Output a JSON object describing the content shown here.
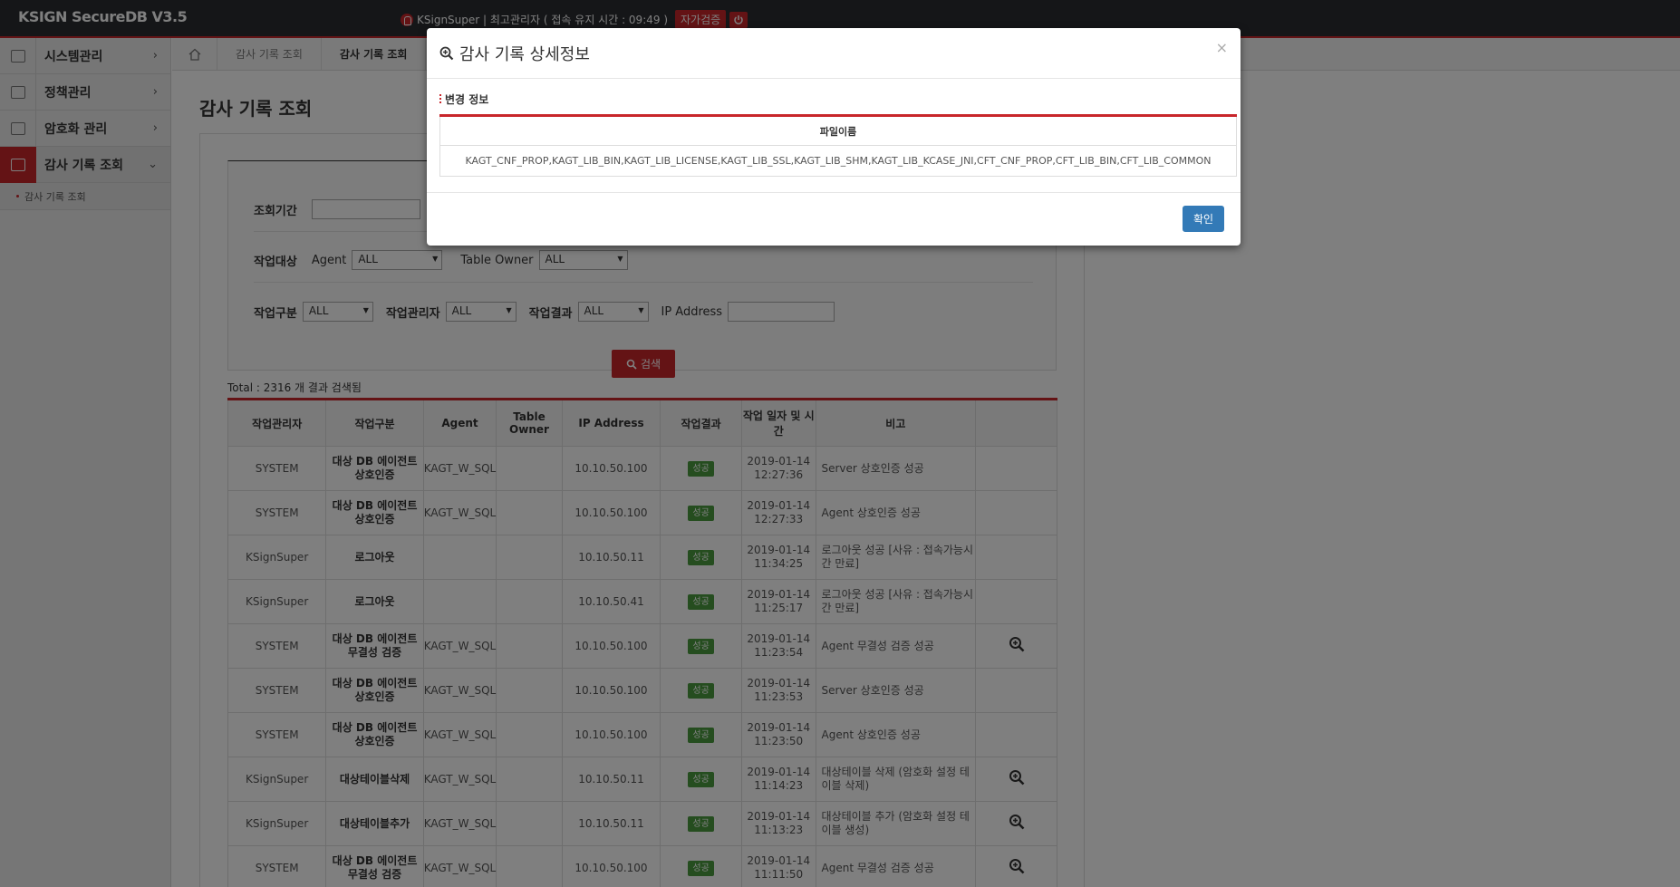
{
  "app": {
    "logo": "KSIGN SecureDB V3.5",
    "user_text": "KSignSuper | 최고관리자 ( 접속 유지 시간 : 09:49 )",
    "verify_label": "자가검증"
  },
  "sidebar": {
    "items": [
      {
        "label": "시스템관리",
        "arrow": "›"
      },
      {
        "label": "정책관리",
        "arrow": "›"
      },
      {
        "label": "암호화 관리",
        "arrow": "›"
      },
      {
        "label": "감사 기록 조회",
        "arrow": "⌄"
      }
    ],
    "sub_items": [
      "감사 기록 조회"
    ]
  },
  "breadcrumb": [
    "감사 기록 조회",
    "감사 기록 조회"
  ],
  "page": {
    "title": "감사 기록 조회"
  },
  "form": {
    "period_label": "조회기간",
    "target_label": "작업대상",
    "agent_label": "Agent",
    "agent_value": "ALL",
    "owner_label": "Table Owner",
    "owner_value": "ALL",
    "type_label": "작업구분",
    "type_value": "ALL",
    "admin_label": "작업관리자",
    "admin_value": "ALL",
    "result_label": "작업결과",
    "result_value": "ALL",
    "ip_label": "IP Address",
    "search_label": "검색"
  },
  "total_text": "Total : 2316 개 결과 검색됨",
  "table": {
    "headers": [
      "작업관리자",
      "작업구분",
      "Agent",
      "Table Owner",
      "IP Address",
      "작업결과",
      "작업 일자 및 시간",
      "비고",
      ""
    ],
    "rows": [
      {
        "admin": "SYSTEM",
        "type": "대상 DB 에이전트 상호인증",
        "agent": "KAGT_W_SQL",
        "owner": "",
        "ip": "10.10.50.100",
        "result": "성공",
        "datetime": "2019-01-14 12:27:36",
        "note": "Server 상호인증 성공",
        "zoom": false
      },
      {
        "admin": "SYSTEM",
        "type": "대상 DB 에이전트 상호인증",
        "agent": "KAGT_W_SQL",
        "owner": "",
        "ip": "10.10.50.100",
        "result": "성공",
        "datetime": "2019-01-14 12:27:33",
        "note": "Agent 상호인증 성공",
        "zoom": false
      },
      {
        "admin": "KSignSuper",
        "type": "로그아웃",
        "agent": "",
        "owner": "",
        "ip": "10.10.50.11",
        "result": "성공",
        "datetime": "2019-01-14 11:34:25",
        "note": "로그아웃 성공 [사유 : 접속가능시간 만료]",
        "zoom": false
      },
      {
        "admin": "KSignSuper",
        "type": "로그아웃",
        "agent": "",
        "owner": "",
        "ip": "10.10.50.41",
        "result": "성공",
        "datetime": "2019-01-14 11:25:17",
        "note": "로그아웃 성공 [사유 : 접속가능시간 만료]",
        "zoom": false
      },
      {
        "admin": "SYSTEM",
        "type": "대상 DB 에이전트 무결성 검증",
        "agent": "KAGT_W_SQL",
        "owner": "",
        "ip": "10.10.50.100",
        "result": "성공",
        "datetime": "2019-01-14 11:23:54",
        "note": "Agent 무결성 검증 성공",
        "zoom": true
      },
      {
        "admin": "SYSTEM",
        "type": "대상 DB 에이전트 상호인증",
        "agent": "KAGT_W_SQL",
        "owner": "",
        "ip": "10.10.50.100",
        "result": "성공",
        "datetime": "2019-01-14 11:23:53",
        "note": "Server 상호인증 성공",
        "zoom": false
      },
      {
        "admin": "SYSTEM",
        "type": "대상 DB 에이전트 상호인증",
        "agent": "KAGT_W_SQL",
        "owner": "",
        "ip": "10.10.50.100",
        "result": "성공",
        "datetime": "2019-01-14 11:23:50",
        "note": "Agent 상호인증 성공",
        "zoom": false
      },
      {
        "admin": "KSignSuper",
        "type": "대상테이블삭제",
        "agent": "KAGT_W_SQL",
        "owner": "",
        "ip": "10.10.50.11",
        "result": "성공",
        "datetime": "2019-01-14 11:14:23",
        "note": "대상테이블 삭제 (암호화 설정 테이블 삭제)",
        "zoom": true
      },
      {
        "admin": "KSignSuper",
        "type": "대상테이블추가",
        "agent": "KAGT_W_SQL",
        "owner": "",
        "ip": "10.10.50.11",
        "result": "성공",
        "datetime": "2019-01-14 11:13:23",
        "note": "대상테이블 추가 (암호화 설정 테이블 생성)",
        "zoom": true
      },
      {
        "admin": "SYSTEM",
        "type": "대상 DB 에이전트 무결성 검증",
        "agent": "KAGT_W_SQL",
        "owner": "",
        "ip": "10.10.50.100",
        "result": "성공",
        "datetime": "2019-01-14 11:11:50",
        "note": "Agent 무결성 검증 성공",
        "zoom": true
      }
    ]
  },
  "modal": {
    "title": "감사 기록 상세정보",
    "section": "변경 정보",
    "column": "파일이름",
    "value": "KAGT_CNF_PROP,KAGT_LIB_BIN,KAGT_LIB_LICENSE,KAGT_LIB_SSL,KAGT_LIB_SHM,KAGT_LIB_KCASE_JNI,CFT_CNF_PROP,CFT_LIB_BIN,CFT_LIB_COMMON",
    "close": "×",
    "ok_label": "확인"
  },
  "colors": {
    "accent": "#c8262b",
    "primary": "#337ab7",
    "success": "#4a9b3f",
    "topbar": "#2a2d31"
  }
}
